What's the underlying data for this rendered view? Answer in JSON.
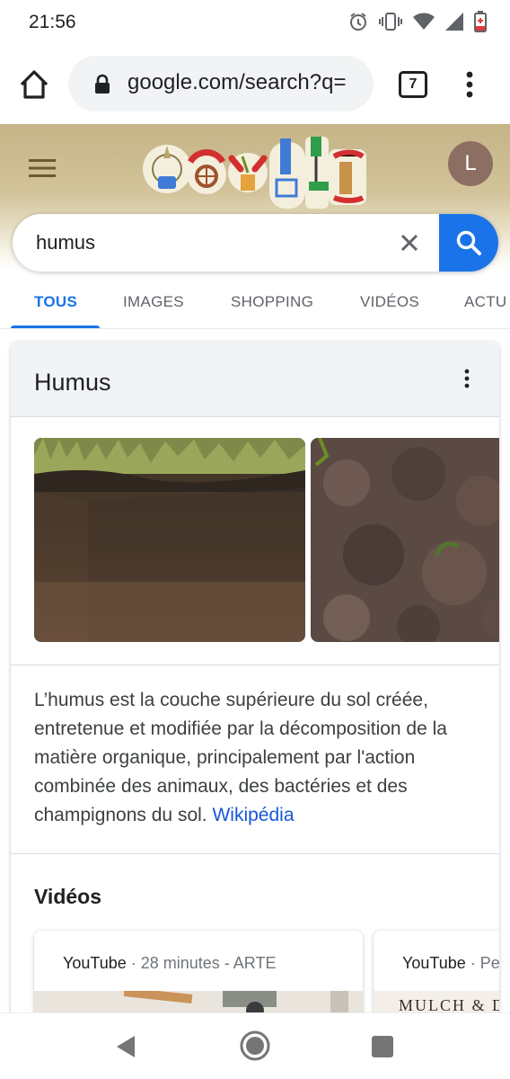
{
  "status_bar": {
    "time": "21:56"
  },
  "browser": {
    "url": "google.com/search?q=",
    "tab_count": "7"
  },
  "header": {
    "avatar_letter": "L",
    "doodle_icon": "google-doodle"
  },
  "search": {
    "query": "humus"
  },
  "tabs": [
    {
      "label": "TOUS",
      "active": true
    },
    {
      "label": "IMAGES"
    },
    {
      "label": "SHOPPING"
    },
    {
      "label": "VIDÉOS"
    },
    {
      "label": "ACTU"
    }
  ],
  "knowledge_panel": {
    "title": "Humus",
    "description": "L’humus est la couche supérieure du sol créée, entretenue et modifiée par la décomposition de la matière organique, principalement par l'action combinée des animaux, des bactéries et des champignons du sol.",
    "source_link": "Wikipédia"
  },
  "videos": {
    "title": "Vidéos",
    "items": [
      {
        "source": "YouTube",
        "meta": " · 28 minutes - ARTE"
      },
      {
        "source": "YouTube",
        "meta": " · Perma"
      }
    ],
    "thumb2_text": "MULCH & DIVE"
  },
  "colors": {
    "accent": "#1a73e8",
    "doodle_band": "#c5b487",
    "avatar": "#8d6e63",
    "link": "#1558d6"
  }
}
